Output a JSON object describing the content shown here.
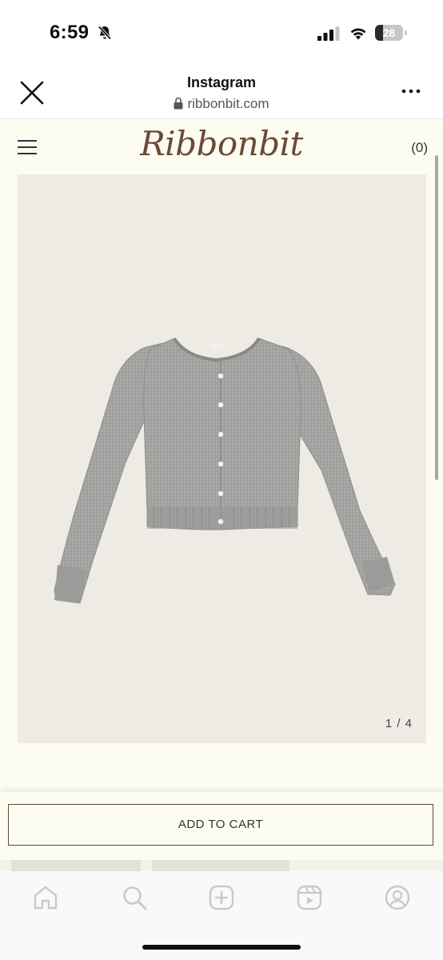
{
  "status_bar": {
    "time": "6:59",
    "battery": "28",
    "battery_level": 0.28,
    "icons": [
      "bell-muted-icon",
      "signal-icon",
      "wifi-icon",
      "battery-icon"
    ]
  },
  "browser": {
    "title": "Instagram",
    "url": "ribbonbit.com",
    "icons": [
      "close-icon",
      "lock-icon",
      "more-icon"
    ]
  },
  "site": {
    "logo": "Ribbonbit",
    "cart_count": "(0)",
    "menu_icon": "hamburger-menu-icon",
    "brand_color": "#6b4a37"
  },
  "product": {
    "image_alt": "grey knit cardigan",
    "image_counter": "1 / 4"
  },
  "actions": {
    "add_to_cart": "ADD TO CART"
  },
  "tab_bar": {
    "tabs": [
      "home-icon",
      "search-icon",
      "create-icon",
      "reels-icon",
      "profile-icon"
    ]
  }
}
